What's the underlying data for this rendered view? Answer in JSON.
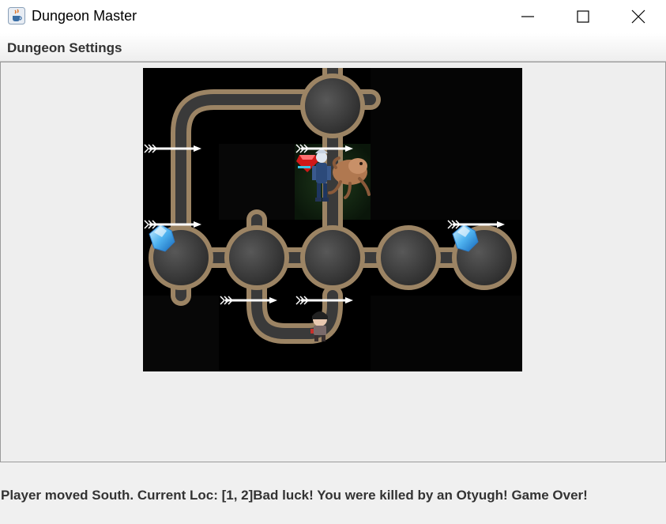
{
  "window": {
    "title": "Dungeon Master",
    "app_icon": "java-cup-icon"
  },
  "window_controls": [
    "minimize-icon",
    "maximize-icon",
    "close-icon"
  ],
  "menu": {
    "items": [
      {
        "label": "Dungeon Settings"
      }
    ]
  },
  "dungeon": {
    "rows": 4,
    "cols": 5,
    "tunnel_color": "#3a3a3a",
    "rim_color": "#9c8464",
    "background_color": "#000000",
    "player_row": 1,
    "player_col": 2,
    "contents": [
      {
        "type": "arrow",
        "row": 1,
        "col": 0
      },
      {
        "type": "arrow",
        "row": 1,
        "col": 2
      },
      {
        "type": "player",
        "row": 1,
        "col": 2
      },
      {
        "type": "otyugh",
        "row": 1,
        "col": 2
      },
      {
        "type": "ruby",
        "row": 1,
        "col": 2
      },
      {
        "type": "sapphire",
        "row": 2,
        "col": 0
      },
      {
        "type": "arrow",
        "row": 2,
        "col": 0
      },
      {
        "type": "sapphire",
        "row": 2,
        "col": 4
      },
      {
        "type": "arrow",
        "row": 2,
        "col": 4
      },
      {
        "type": "arrow",
        "row": 3,
        "col": 1
      },
      {
        "type": "arrow",
        "row": 3,
        "col": 2
      },
      {
        "type": "thief",
        "row": 3,
        "col": 2
      }
    ]
  },
  "status": {
    "message": "Player moved South. Current Loc: [1, 2]Bad luck! You were killed by an Otyugh! Game Over!"
  }
}
